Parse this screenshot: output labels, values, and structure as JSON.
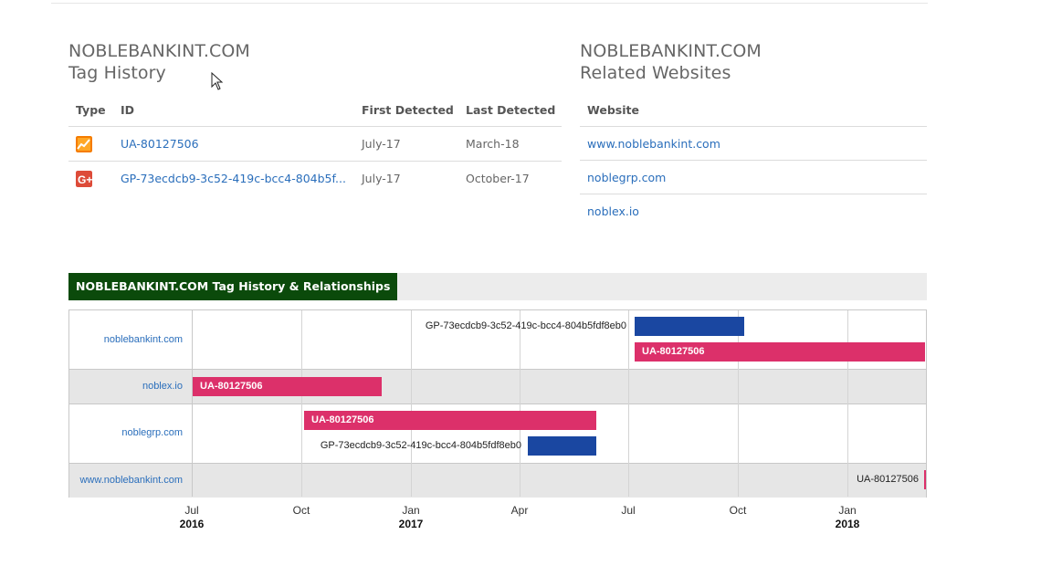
{
  "tag_history": {
    "domain": "NOBLEBANKINT.COM",
    "subtitle": "Tag History",
    "headers": {
      "type": "Type",
      "id": "ID",
      "first": "First Detected",
      "last": "Last Detected"
    },
    "rows": [
      {
        "icon": "google-analytics-icon",
        "id": "UA-80127506",
        "first": "July-17",
        "last": "March-18"
      },
      {
        "icon": "google-plus-icon",
        "id": "GP-73ecdcb9-3c52-419c-bcc4-804b5f...",
        "first": "July-17",
        "last": "October-17"
      }
    ]
  },
  "related": {
    "domain": "NOBLEBANKINT.COM",
    "subtitle": "Related Websites",
    "header": "Website",
    "sites": [
      "www.noblebankint.com",
      "noblegrp.com",
      "noblex.io"
    ]
  },
  "timeline": {
    "title": "NOBLEBANKINT.COM Tag History & Relationships",
    "rows": [
      {
        "site": "noblebankint.com",
        "bars": [
          {
            "label": "GP-73ecdcb9-3c52-419c-bcc4-804b5fdf8eb0",
            "color": "#1a47a1"
          },
          {
            "label": "UA-80127506",
            "color": "#dc306a"
          }
        ]
      },
      {
        "site": "noblex.io",
        "bars": [
          {
            "label": "UA-80127506",
            "color": "#dc306a"
          }
        ]
      },
      {
        "site": "noblegrp.com",
        "bars": [
          {
            "label": "UA-80127506",
            "color": "#dc306a"
          },
          {
            "label": "GP-73ecdcb9-3c52-419c-bcc4-804b5fdf8eb0",
            "color": "#1a47a1"
          }
        ]
      },
      {
        "site": "www.noblebankint.com",
        "bars": [
          {
            "label": "UA-80127506",
            "color": "#dc306a"
          }
        ]
      }
    ],
    "axis": [
      {
        "month": "Jul",
        "year": "2016"
      },
      {
        "month": "Oct",
        "year": ""
      },
      {
        "month": "Jan",
        "year": "2017"
      },
      {
        "month": "Apr",
        "year": ""
      },
      {
        "month": "Jul",
        "year": ""
      },
      {
        "month": "Oct",
        "year": ""
      },
      {
        "month": "Jan",
        "year": "2018"
      }
    ]
  },
  "colors": {
    "accent_green": "#0b4a0b",
    "link_blue": "#2a6ebb",
    "ua_pink": "#dc306a",
    "gp_blue": "#1a47a1"
  }
}
